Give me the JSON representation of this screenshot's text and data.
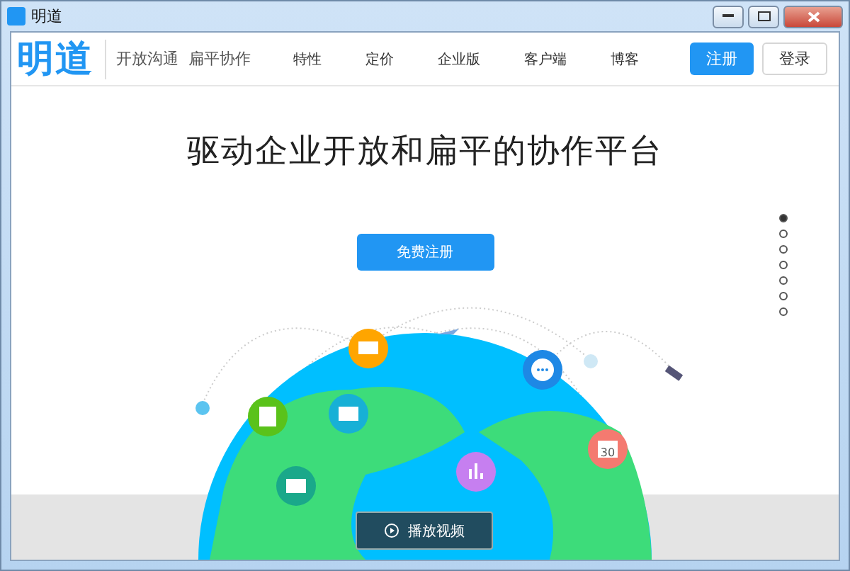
{
  "window": {
    "title": "明道"
  },
  "header": {
    "logo": "明道",
    "slogan": "开放沟通  扁平协作",
    "nav": [
      {
        "label": "特性"
      },
      {
        "label": "定价"
      },
      {
        "label": "企业版"
      },
      {
        "label": "客户端"
      },
      {
        "label": "博客"
      }
    ],
    "register": "注册",
    "login": "登录"
  },
  "hero": {
    "title": "驱动企业开放和扁平的协作平台",
    "cta": "免费注册",
    "calendar_day": "30",
    "video_button": "播放视频"
  },
  "pager": [
    {
      "selected": true
    },
    {
      "selected": false
    },
    {
      "selected": false
    },
    {
      "selected": false
    },
    {
      "selected": false
    },
    {
      "selected": false
    },
    {
      "selected": false
    }
  ]
}
